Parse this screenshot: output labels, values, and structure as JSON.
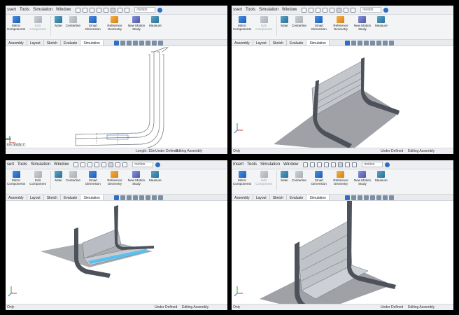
{
  "panels": [
    {
      "id": "tl",
      "menu": [
        "ssert",
        "Tools",
        "Simulation",
        "Window"
      ],
      "search": "motion",
      "ribbon": [
        {
          "label": "Mirror Components",
          "disabled": false,
          "icon": "mirror-components-icon"
        },
        {
          "label": "Edit Component",
          "disabled": true,
          "icon": "edit-component-icon"
        },
        {
          "label": "Mate",
          "disabled": false,
          "icon": "mate-icon"
        },
        {
          "label": "Centerline",
          "disabled": false,
          "icon": "centerline-icon"
        },
        {
          "label": "Smart Dimension",
          "disabled": false,
          "icon": "smart-dimension-icon"
        },
        {
          "label": "Reference Geometry",
          "disabled": false,
          "icon": "reference-geometry-icon"
        },
        {
          "label": "New Motion Study",
          "disabled": false,
          "icon": "new-motion-study-icon"
        },
        {
          "label": "Measure",
          "disabled": false,
          "icon": "measure-icon"
        }
      ],
      "tabs": [
        "Assembly",
        "Layout",
        "Sketch",
        "Evaluate",
        "Simulation"
      ],
      "active_tab": "Simulation",
      "tree_text": "ack",
      "tree_sub": "ion Study 2",
      "status": {
        "length": "Length: 15in",
        "defined": "Under Defined",
        "mode": "Editing Assembly"
      }
    },
    {
      "id": "tr",
      "menu": [
        "ssert",
        "Tools",
        "Simulation",
        "Window"
      ],
      "search": "motion",
      "ribbon": [
        {
          "label": "Mirror Components",
          "disabled": false,
          "icon": "mirror-components-icon"
        },
        {
          "label": "Edit Component",
          "disabled": true,
          "icon": "edit-component-icon"
        },
        {
          "label": "Mate",
          "disabled": false,
          "icon": "mate-icon"
        },
        {
          "label": "Centerline",
          "disabled": false,
          "icon": "centerline-icon"
        },
        {
          "label": "Smart Dimension",
          "disabled": false,
          "icon": "smart-dimension-icon"
        },
        {
          "label": "Reference Geometry",
          "disabled": false,
          "icon": "reference-geometry-icon"
        },
        {
          "label": "New Motion Study",
          "disabled": false,
          "icon": "new-motion-study-icon"
        },
        {
          "label": "Measure",
          "disabled": false,
          "icon": "measure-icon"
        }
      ],
      "tabs": [
        "Assembly",
        "Layout",
        "Sketch",
        "Evaluate",
        "Simulation"
      ],
      "active_tab": "Simulation",
      "status_left": "Only",
      "status": {
        "defined": "Under Defined",
        "mode": "Editing Assembly"
      }
    },
    {
      "id": "bl",
      "menu": [
        "sert",
        "Tools",
        "Simulation",
        "Window"
      ],
      "search": "motion",
      "ribbon": [
        {
          "label": "Mirror Components",
          "disabled": false,
          "icon": "mirror-components-icon"
        },
        {
          "label": "Edit Component",
          "disabled": false,
          "icon": "edit-component-icon"
        },
        {
          "label": "Mate",
          "disabled": false,
          "icon": "mate-icon"
        },
        {
          "label": "Centerline",
          "disabled": false,
          "icon": "centerline-icon"
        },
        {
          "label": "Smart Dimension",
          "disabled": false,
          "icon": "smart-dimension-icon"
        },
        {
          "label": "Reference Geometry",
          "disabled": false,
          "icon": "reference-geometry-icon"
        },
        {
          "label": "New Motion Study",
          "disabled": false,
          "icon": "new-motion-study-icon"
        },
        {
          "label": "Measure",
          "disabled": false,
          "icon": "measure-icon"
        }
      ],
      "tabs": [
        "Assembly",
        "Layout",
        "Sketch",
        "Evaluate",
        "Simulation"
      ],
      "active_tab": "Simulation",
      "status_left": "Only",
      "status": {
        "defined": "Under Defined",
        "mode": "Editing Assembly"
      }
    },
    {
      "id": "br",
      "menu": [
        "Insert",
        "Tools",
        "Simulation",
        "Window"
      ],
      "search": "motion",
      "ribbon": [
        {
          "label": "Mirror Components",
          "disabled": false,
          "icon": "mirror-components-icon"
        },
        {
          "label": "Edit Component",
          "disabled": true,
          "icon": "edit-component-icon"
        },
        {
          "label": "Mate",
          "disabled": false,
          "icon": "mate-icon"
        },
        {
          "label": "Centerline",
          "disabled": false,
          "icon": "centerline-icon"
        },
        {
          "label": "Smart Dimension",
          "disabled": false,
          "icon": "smart-dimension-icon"
        },
        {
          "label": "Reference Geometry",
          "disabled": false,
          "icon": "reference-geometry-icon"
        },
        {
          "label": "New Motion Study",
          "disabled": false,
          "icon": "new-motion-study-icon"
        },
        {
          "label": "Measure",
          "disabled": false,
          "icon": "measure-icon"
        }
      ],
      "tabs": [
        "Assembly",
        "Layout",
        "Sketch",
        "Evaluate",
        "Simulation"
      ],
      "active_tab": "Simulation",
      "status_left": "Only",
      "status": {
        "defined": "Under Defined",
        "mode": "Editing Assembly"
      }
    }
  ],
  "colors": {
    "accent": "#2e6fc4",
    "model_metal": "#8a8f97",
    "model_dark": "#4a4f57",
    "shadow": "#8e9196",
    "highlight": "#5bc0f0"
  }
}
